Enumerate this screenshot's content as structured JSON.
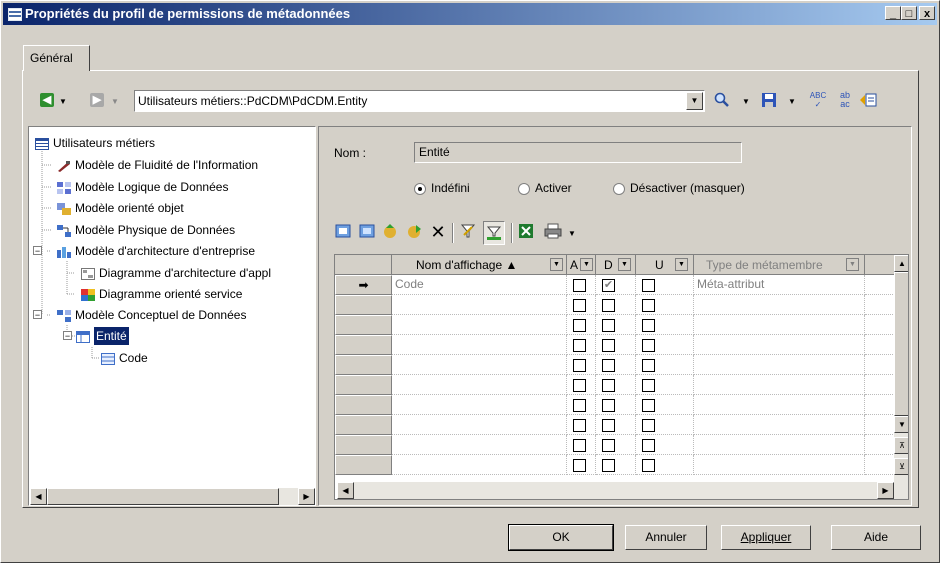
{
  "window": {
    "title": "Propriétés du profil de permissions de métadonnées",
    "min_glyph": "_",
    "max_glyph": "□",
    "close_glyph": "x"
  },
  "tabs": [
    {
      "label": "Général"
    }
  ],
  "location": {
    "value": "Utilisateurs métiers::PdCDM\\PdCDM.Entity"
  },
  "tree": {
    "items": [
      {
        "label": "Utilisateurs métiers",
        "icon": "list-icon"
      },
      {
        "label": "Modèle de Fluidité de l'Information",
        "icon": "ilm-model-icon"
      },
      {
        "label": "Modèle Logique de Données",
        "icon": "ldm-model-icon"
      },
      {
        "label": "Modèle orienté objet",
        "icon": "oom-model-icon"
      },
      {
        "label": "Modèle Physique de Données",
        "icon": "pdm-model-icon"
      },
      {
        "label": "Modèle d'architecture d'entreprise",
        "icon": "eam-model-icon"
      },
      {
        "label": "Diagramme d'architecture d'appl",
        "icon": "diagram-icon"
      },
      {
        "label": "Diagramme orienté service",
        "icon": "soa-diagram-icon"
      },
      {
        "label": "Modèle Conceptuel de Données",
        "icon": "cdm-model-icon"
      },
      {
        "label": "Entité",
        "icon": "entity-icon"
      },
      {
        "label": "Code",
        "icon": "attribute-icon"
      }
    ]
  },
  "form": {
    "name_label": "Nom :",
    "name_value": "Entité",
    "radios": [
      {
        "label": "Indéfini",
        "checked": true
      },
      {
        "label": "Activer",
        "checked": false
      },
      {
        "label": "Désactiver (masquer)",
        "checked": false
      }
    ]
  },
  "grid": {
    "columns": [
      {
        "label": "Nom d'affichage ▲"
      },
      {
        "label": "A"
      },
      {
        "label": "D"
      },
      {
        "label": "U"
      },
      {
        "label": "Type de métamembre"
      }
    ],
    "current_row_marker": "➡",
    "rows": [
      {
        "name": "Code",
        "a": false,
        "d": true,
        "u": false,
        "type": "Méta-attribut"
      },
      {
        "name": "",
        "a": false,
        "d": false,
        "u": false,
        "type": ""
      },
      {
        "name": "",
        "a": false,
        "d": false,
        "u": false,
        "type": ""
      },
      {
        "name": "",
        "a": false,
        "d": false,
        "u": false,
        "type": ""
      },
      {
        "name": "",
        "a": false,
        "d": false,
        "u": false,
        "type": ""
      },
      {
        "name": "",
        "a": false,
        "d": false,
        "u": false,
        "type": ""
      },
      {
        "name": "",
        "a": false,
        "d": false,
        "u": false,
        "type": ""
      },
      {
        "name": "",
        "a": false,
        "d": false,
        "u": false,
        "type": ""
      },
      {
        "name": "",
        "a": false,
        "d": false,
        "u": false,
        "type": ""
      },
      {
        "name": "",
        "a": false,
        "d": false,
        "u": false,
        "type": ""
      }
    ]
  },
  "buttons": {
    "ok": "OK",
    "cancel": "Annuler",
    "apply": "Appliquer",
    "help": "Aide"
  },
  "colors": {
    "title_bar": "#0a246a",
    "selection": "#0a246a",
    "face": "#d4d0c8"
  }
}
